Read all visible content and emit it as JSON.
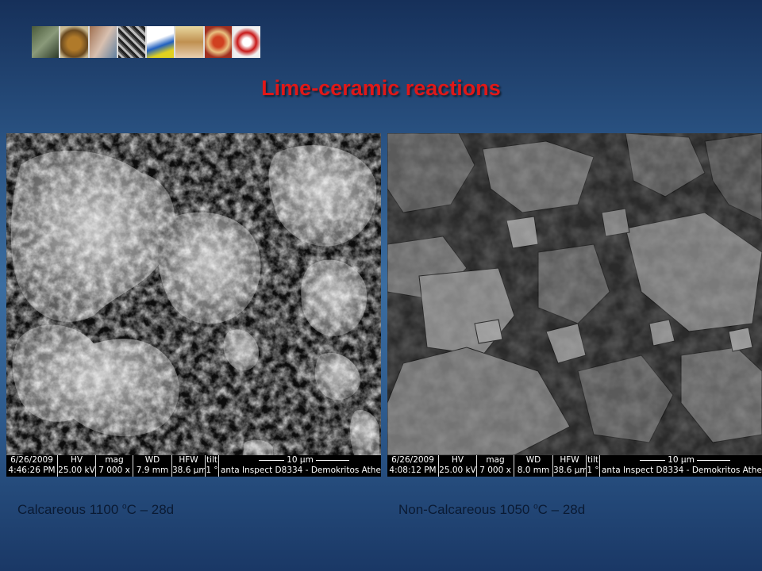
{
  "slide": {
    "title": "Lime-ceramic reactions",
    "logo_strip_name": "header-logo-strip"
  },
  "left": {
    "databar": {
      "date": "6/26/2009",
      "time": "4:46:26 PM",
      "hv_label": "HV",
      "hv": "25.00 kV",
      "mag_label": "mag",
      "mag": "7 000 x",
      "wd_label": "WD",
      "wd": "7.9 mm",
      "hfw_label": "HFW",
      "hfw": "38.6 µm",
      "tilt_label": "tilt",
      "tilt": "1 °",
      "scale": "10 µm",
      "instrument": "anta Inspect D8334 - Demokritos Athe"
    },
    "caption": {
      "prefix": "Calcareous 1100 ",
      "sup": "o",
      "suffix": "C – 28d"
    }
  },
  "right": {
    "databar": {
      "date": "6/26/2009",
      "time": "4:08:12 PM",
      "hv_label": "HV",
      "hv": "25.00 kV",
      "mag_label": "mag",
      "mag": "7 000 x",
      "wd_label": "WD",
      "wd": "8.0 mm",
      "hfw_label": "HFW",
      "hfw": "38.6 µm",
      "tilt_label": "tilt",
      "tilt": "1 °",
      "scale": "10 µm",
      "instrument": "anta Inspect D8334 - Demokritos Athe"
    },
    "caption": {
      "prefix": "Non-Calcareous 1050 ",
      "sup": "o",
      "suffix": "C – 28d"
    }
  }
}
